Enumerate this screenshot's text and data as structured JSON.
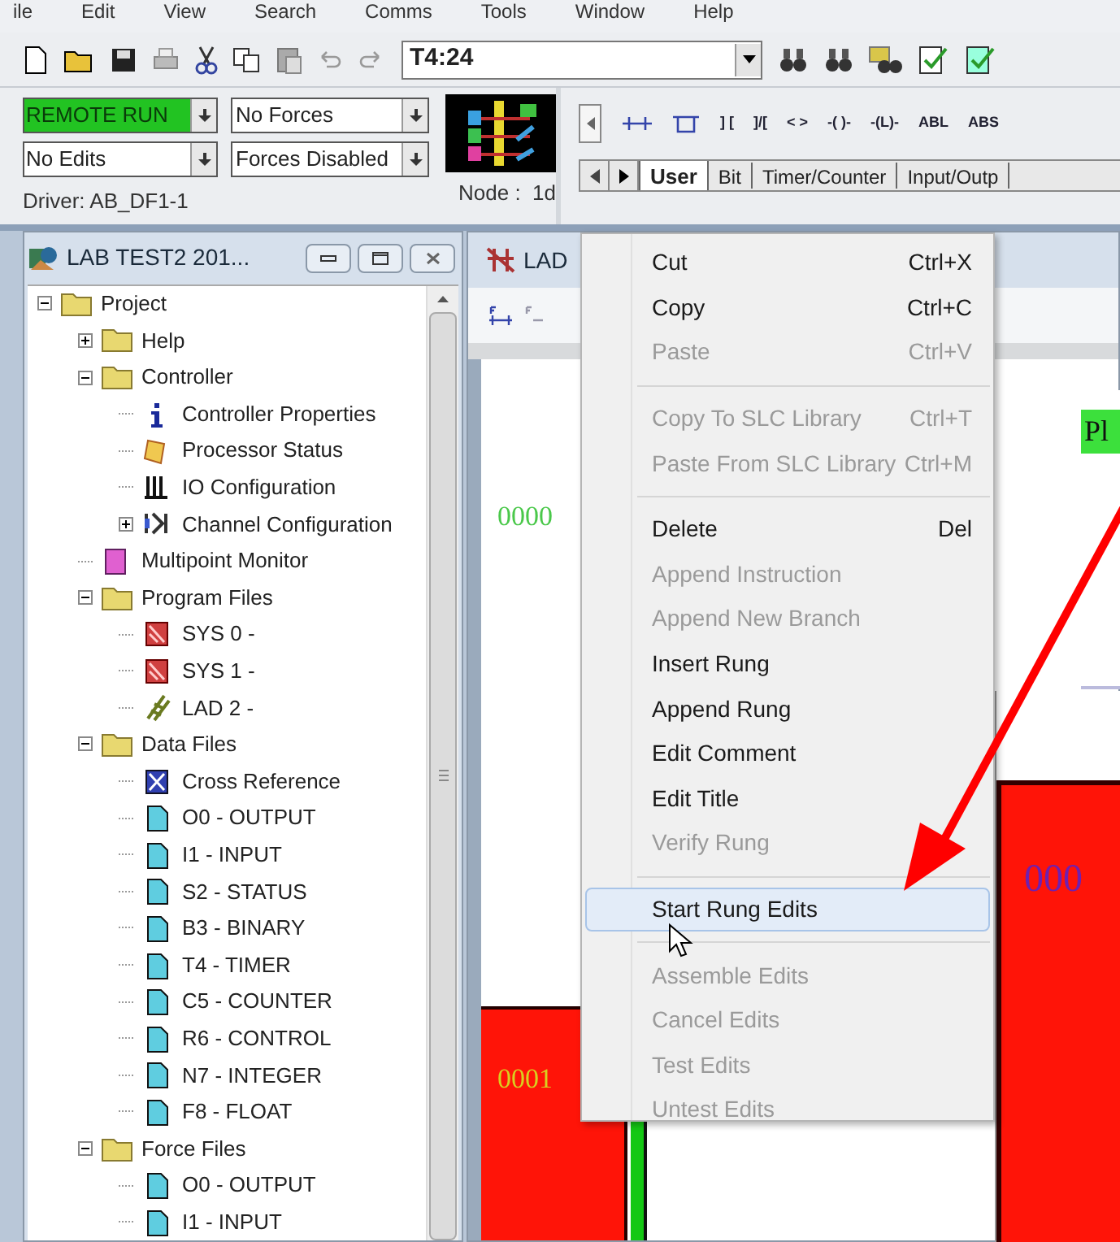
{
  "menu_bar": [
    "ile",
    "Edit",
    "View",
    "Search",
    "Comms",
    "Tools",
    "Window",
    "Help"
  ],
  "address_combo": {
    "value": "T4:24"
  },
  "status": {
    "mode": "REMOTE RUN",
    "edits": "No Edits",
    "forces": "No Forces",
    "forces_enabled": "Forces Disabled",
    "driver": "Driver: AB_DF1-1",
    "node": "Node :  1d"
  },
  "instruction_palette": [
    "] [",
    "]/[",
    "< >",
    "-( )-",
    "-(L)-",
    "ABL",
    "ABS"
  ],
  "palette_tabs": [
    {
      "label": "User",
      "selected": true
    },
    {
      "label": "Bit",
      "selected": false
    },
    {
      "label": "Timer/Counter",
      "selected": false
    },
    {
      "label": "Input/Outp",
      "selected": false
    }
  ],
  "project_window": {
    "title": "LAB TEST2 201...",
    "tree": [
      {
        "label": "Project",
        "kind": "folder",
        "expanded": true,
        "children": [
          {
            "label": "Help",
            "kind": "folder",
            "expanded": false
          },
          {
            "label": "Controller",
            "kind": "folder",
            "expanded": true,
            "children": [
              {
                "label": "Controller Properties",
                "kind": "info"
              },
              {
                "label": "Processor Status",
                "kind": "processor"
              },
              {
                "label": "IO Configuration",
                "kind": "io"
              },
              {
                "label": "Channel Configuration",
                "kind": "channel",
                "expanded": false
              }
            ]
          },
          {
            "label": "Multipoint Monitor",
            "kind": "monitor"
          },
          {
            "label": "Program Files",
            "kind": "folder",
            "expanded": true,
            "children": [
              {
                "label": "SYS 0 -",
                "kind": "program"
              },
              {
                "label": "SYS 1 -",
                "kind": "program"
              },
              {
                "label": "LAD 2 -",
                "kind": "ladder"
              }
            ]
          },
          {
            "label": "Data Files",
            "kind": "folder",
            "expanded": true,
            "children": [
              {
                "label": "Cross Reference",
                "kind": "crossref"
              },
              {
                "label": "O0 - OUTPUT",
                "kind": "datafile"
              },
              {
                "label": "I1 - INPUT",
                "kind": "datafile"
              },
              {
                "label": "S2 - STATUS",
                "kind": "datafile"
              },
              {
                "label": "B3 - BINARY",
                "kind": "datafile"
              },
              {
                "label": "T4 - TIMER",
                "kind": "datafile"
              },
              {
                "label": "C5 - COUNTER",
                "kind": "datafile"
              },
              {
                "label": "R6 - CONTROL",
                "kind": "datafile"
              },
              {
                "label": "N7 - INTEGER",
                "kind": "datafile"
              },
              {
                "label": "F8 - FLOAT",
                "kind": "datafile"
              }
            ]
          },
          {
            "label": "Force Files",
            "kind": "folder",
            "expanded": true,
            "children": [
              {
                "label": "O0 - OUTPUT",
                "kind": "datafile"
              },
              {
                "label": "I1 - INPUT",
                "kind": "datafile"
              }
            ]
          }
        ]
      }
    ]
  },
  "ladder_window": {
    "title": "LAD",
    "rungs": [
      {
        "number": "0000",
        "faulted": false
      },
      {
        "number": "0001",
        "faulted": true
      }
    ]
  },
  "second_window": {
    "rung_number": "000",
    "instruction_label": "Pl"
  },
  "context_menu": {
    "groups": [
      [
        {
          "label": "Cut",
          "shortcut": "Ctrl+X",
          "disabled": false,
          "selected": false
        },
        {
          "label": "Copy",
          "shortcut": "Ctrl+C",
          "disabled": false,
          "selected": false
        },
        {
          "label": "Paste",
          "shortcut": "Ctrl+V",
          "disabled": true,
          "selected": false
        }
      ],
      [
        {
          "label": "Copy To SLC Library",
          "shortcut": "Ctrl+T",
          "disabled": true,
          "selected": false
        },
        {
          "label": "Paste From SLC Library",
          "shortcut": "Ctrl+M",
          "disabled": true,
          "selected": false
        }
      ],
      [
        {
          "label": "Delete",
          "shortcut": "Del",
          "disabled": false,
          "selected": false
        },
        {
          "label": "Append Instruction",
          "disabled": true,
          "selected": false
        },
        {
          "label": "Append New Branch",
          "disabled": true,
          "selected": false
        },
        {
          "label": "Insert Rung",
          "disabled": false,
          "selected": false
        },
        {
          "label": "Append Rung",
          "disabled": false,
          "selected": false
        },
        {
          "label": "Edit Comment",
          "disabled": false,
          "selected": false
        },
        {
          "label": "Edit Title",
          "disabled": false,
          "selected": false
        },
        {
          "label": "Verify Rung",
          "disabled": true,
          "selected": false
        }
      ],
      [
        {
          "label": "Start Rung Edits",
          "disabled": false,
          "selected": true
        }
      ],
      [
        {
          "label": "Assemble Edits",
          "disabled": true,
          "selected": false
        },
        {
          "label": "Cancel Edits",
          "disabled": true,
          "selected": false
        },
        {
          "label": "Test Edits",
          "disabled": true,
          "selected": false
        },
        {
          "label": "Untest Edits",
          "disabled": true,
          "selected": false
        }
      ]
    ]
  }
}
